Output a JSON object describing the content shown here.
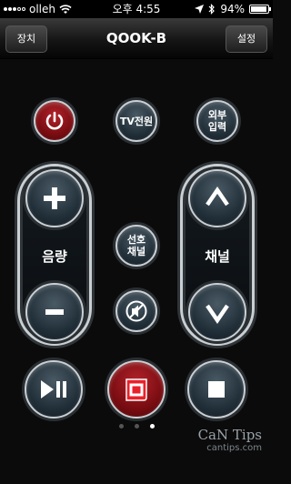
{
  "status": {
    "carrier": "olleh",
    "time": "오후 4:55",
    "battery": "94%",
    "battery_level": 0.94
  },
  "navbar": {
    "left_button": "장치",
    "title": "QOOK-B",
    "right_button": "설정"
  },
  "remote": {
    "power_icon": "power-icon",
    "tv_power": "TV전원",
    "external_input": "외부\n입력",
    "volume": {
      "label": "음량",
      "up_icon": "plus-icon",
      "down_icon": "minus-icon"
    },
    "channel": {
      "label": "채널",
      "up_icon": "chevron-up-icon",
      "down_icon": "chevron-down-icon"
    },
    "favorite_channel": "선호\n채널",
    "mute_icon": "mute-icon",
    "play_pause_icon": "play-pause-icon",
    "home_icon": "olleh-logo-icon",
    "stop_icon": "stop-icon"
  },
  "pager": {
    "total": 3,
    "active": 3
  },
  "watermark": {
    "title": "CaN Tips",
    "subtitle": "cantips.com"
  },
  "colors": {
    "accent_red": "#9a141b",
    "olleh_red": "#e8222b",
    "button_ring": "#c9cfd3",
    "button_fill": "#22303a"
  }
}
